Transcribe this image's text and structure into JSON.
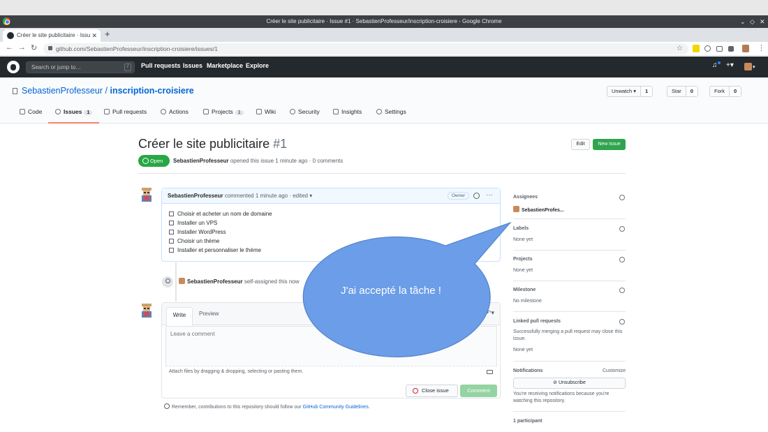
{
  "window": {
    "title": "Créer le site publicitaire · Issue #1 · SebastienProfesseur/inscription-croisiere - Google Chrome",
    "tab_title": "Créer le site publicitaire · Issu",
    "url": "github.com/SebastienProfesseur/inscription-croisiere/issues/1"
  },
  "gh_header": {
    "search_placeholder": "Search or jump to…",
    "search_key": "/",
    "nav": [
      "Pull requests",
      "Issues",
      "Marketplace",
      "Explore"
    ],
    "plus": "+▾"
  },
  "repo": {
    "owner": "SebastienProfesseur",
    "separator": " / ",
    "name": "inscription-croisiere",
    "unwatch_label": "Unwatch ▾",
    "unwatch_count": "1",
    "star_label": "Star",
    "star_count": "0",
    "fork_label": "Fork",
    "fork_count": "0",
    "tabs": [
      {
        "label": "Code"
      },
      {
        "label": "Issues",
        "badge": "1"
      },
      {
        "label": "Pull requests"
      },
      {
        "label": "Actions"
      },
      {
        "label": "Projects",
        "badge": "1"
      },
      {
        "label": "Wiki"
      },
      {
        "label": "Security"
      },
      {
        "label": "Insights"
      },
      {
        "label": "Settings"
      }
    ]
  },
  "issue": {
    "title": "Créer le site publicitaire",
    "number": "#1",
    "edit_label": "Edit",
    "new_issue_label": "New issue",
    "state": "Open",
    "author": "SebastienProfesseur",
    "meta": " opened this issue 1 minute ago · 0 comments"
  },
  "comment": {
    "author": "SebastienProfesseur",
    "meta": " commented 1 minute ago · edited ▾",
    "owner_badge": "Owner",
    "dots": "···",
    "tasks": [
      "Choisir et acheter un nom de domaine",
      "Installer un VPS",
      "Installer WordPress",
      "Choisir un thème",
      "Installer et personnaliser le thème"
    ]
  },
  "event": {
    "actor": "SebastienProfesseur",
    "text": " self-assigned this now"
  },
  "composer": {
    "tab_write": "Write",
    "tab_preview": "Preview",
    "reply": "↶▾",
    "placeholder": "Leave a comment",
    "attach_note": "Attach files by dragging & dropping, selecting or pasting them.",
    "close_issue_label": "Close issue",
    "comment_label": "Comment",
    "remember_prefix": "Remember, contributions to this repository should follow our ",
    "remember_link": "GitHub Community Guidelines",
    "remember_suffix": "."
  },
  "sidebar": {
    "assignees_title": "Assignees",
    "assignee": "SebastienProfes...",
    "labels_title": "Labels",
    "labels_value": "None yet",
    "projects_title": "Projects",
    "projects_value": "None yet",
    "milestone_title": "Milestone",
    "milestone_value": "No milestone",
    "linked_title": "Linked pull requests",
    "linked_desc_1": "Successfully merging a pull request may close this",
    "linked_desc_2": "issue.",
    "linked_value": "None yet",
    "notifications_title": "Notifications",
    "customize": "Customize",
    "unsubscribe_label": "Unsubscribe",
    "notif_desc_1": "You're receiving notifications because you're",
    "notif_desc_2": "watching this repository.",
    "participants": "1 participant"
  },
  "callout": {
    "text": "J'ai accepté la tâche !",
    "fill": "#6b9de8"
  },
  "colors": {
    "accent_link": "#0366d6",
    "open_green": "#28a745",
    "header_dark": "#24292e"
  }
}
